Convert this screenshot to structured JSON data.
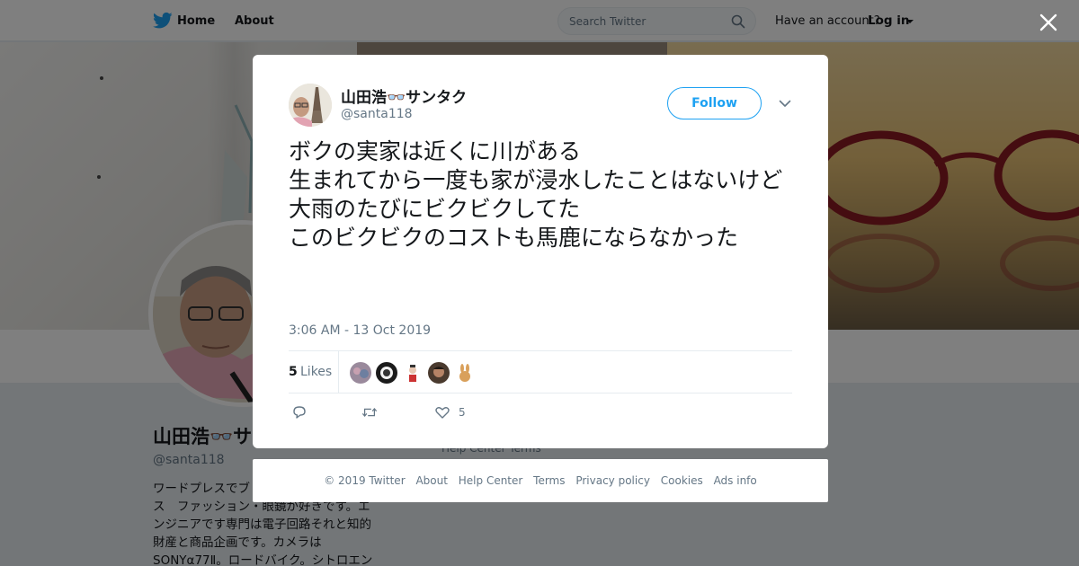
{
  "nav": {
    "home_label": "Home",
    "about_label": "About",
    "search_placeholder": "Search Twitter",
    "account_prompt": "Have an account?",
    "login_label": "Log in"
  },
  "profile": {
    "name": "山田浩👓サンタク",
    "handle": "@santa118",
    "bio_lines": [
      "ワードプレスでブ",
      "ス　ファッション・眼鏡が好きです。エ",
      "ンジニアです専門は電子回路それと知的",
      "財産と商品企画です。カメラは",
      "SONYα77Ⅱ。ロードバイク。シトロエン"
    ]
  },
  "bg_footer_stub": "Help Center   Terms",
  "tweet": {
    "author_name": "山田浩👓サンタク",
    "author_handle": "@santa118",
    "follow_label": "Follow",
    "lines": [
      "ボクの実家は近くに川がある",
      "生まれてから一度も家が浸水したことはないけど",
      "大雨のたびにビクビクしてた",
      "このビクビクのコストも馬鹿にならなかった"
    ],
    "timestamp": "3:06 AM - 13 Oct 2019",
    "likes_count": "5",
    "likes_label": "Likes",
    "like_action_count": "5"
  },
  "footer": {
    "links": [
      "© 2019 Twitter",
      "About",
      "Help Center",
      "Terms",
      "Privacy policy",
      "Cookies",
      "Ads info"
    ]
  },
  "colors": {
    "brand_blue": "#1da1f2",
    "text_primary": "#14171a",
    "text_secondary": "#657786",
    "overlay": "rgba(0,0,0,0.5)"
  },
  "icons": [
    "twitter-bird-icon",
    "search-icon",
    "close-icon",
    "chevron-down-icon",
    "reply-icon",
    "retweet-icon",
    "heart-icon"
  ]
}
